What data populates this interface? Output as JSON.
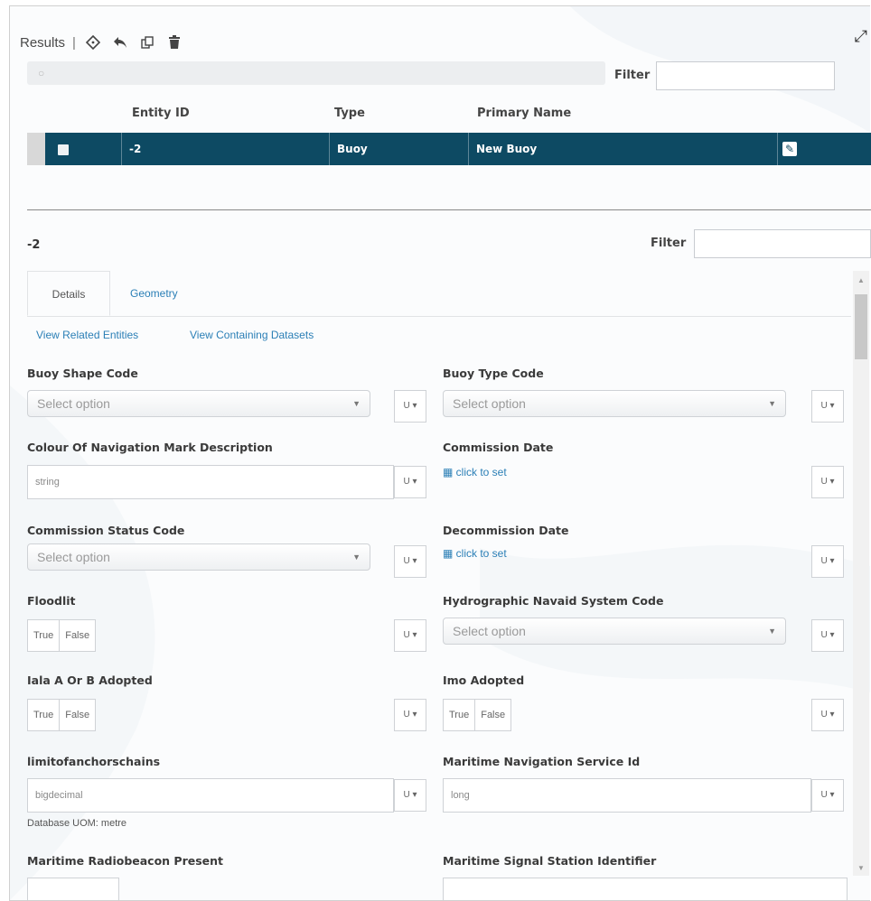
{
  "results": {
    "title": "Results",
    "separator": "|",
    "toolbar_icons": [
      "target-icon",
      "reply-icon",
      "copy-icon",
      "trash-icon"
    ],
    "search_placeholder": "○",
    "filter_label": "Filter",
    "columns": [
      "Entity ID",
      "Type",
      "Primary Name"
    ],
    "rows": [
      {
        "entity_id": "-2",
        "type": "Buoy",
        "primary_name": "New Buoy"
      }
    ]
  },
  "detail": {
    "entity_title": "-2",
    "filter_label": "Filter",
    "tabs": [
      "Details",
      "Geometry"
    ],
    "links": [
      "View Related Entities",
      "View Containing Datasets"
    ],
    "unit_label": "U ▾",
    "select_placeholder": "Select option",
    "true_label": "True",
    "false_label": "False",
    "click_to_set": "click to set",
    "fields": {
      "buoy_shape_code": "Buoy Shape Code",
      "buoy_type_code": "Buoy Type Code",
      "colour_desc": "Colour Of Navigation Mark Description",
      "colour_desc_value": "string",
      "commission_date": "Commission Date",
      "commission_status_code": "Commission Status Code",
      "decommission_date": "Decommission Date",
      "floodlit": "Floodlit",
      "hydrographic_code": "Hydrographic Navaid System Code",
      "iala": "Iala A Or B Adopted",
      "imo": "Imo Adopted",
      "limit_anchor": "limitofanchorschains",
      "limit_anchor_value": "bigdecimal",
      "uom": "Database UOM: metre",
      "maritime_nav_service": "Maritime Navigation Service Id",
      "maritime_nav_service_value": "long",
      "radiobeacon": "Maritime Radiobeacon Present",
      "signal_station": "Maritime Signal Station Identifier"
    }
  },
  "colors": {
    "selected_row": "#0d4a63",
    "link": "#2b7fb6"
  }
}
